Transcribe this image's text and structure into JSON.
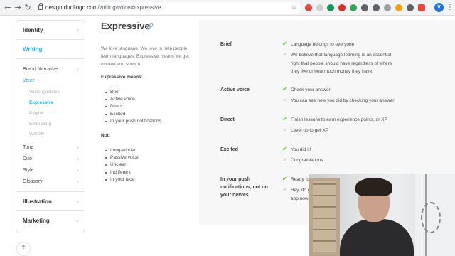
{
  "browser": {
    "nav": {
      "back": "←",
      "forward": "→",
      "reload": "↻"
    },
    "url_domain": "design.duolingo.com",
    "url_path": "/writing/voice#expressive",
    "bookmark_icon": "☆",
    "avatar_letter": "V",
    "menu_icon": "⋮",
    "extension_colors": [
      "#e8453c",
      "#d1d1d1",
      "#0f9d58",
      "#d93025",
      "#34a853",
      "#5f6368",
      "#5f6368",
      "#9aa0a6",
      "#ffa000",
      "#5f6368"
    ]
  },
  "sidebar": {
    "sections": [
      {
        "label": "Identity",
        "chevron": "›"
      },
      {
        "label": "Writing",
        "chevron": ""
      }
    ],
    "items": [
      {
        "label": "Brand Narrative",
        "chevron": "›"
      },
      {
        "label": "Voice",
        "chevron": ""
      }
    ],
    "voice_subitems": [
      "Voice Qualities",
      "Expressive",
      "Playful",
      "Embracing",
      "Worldly"
    ],
    "lower_items": [
      {
        "label": "Tone",
        "chevron": "›"
      },
      {
        "label": "Duo",
        "chevron": "›"
      },
      {
        "label": "Style",
        "chevron": "›"
      },
      {
        "label": "Glossary",
        "chevron": "›"
      }
    ],
    "bottom_sections": [
      {
        "label": "Illustration",
        "chevron": "›"
      },
      {
        "label": "Marketing",
        "chevron": "›"
      }
    ],
    "back_to_top_icon": "↑"
  },
  "main": {
    "title": "Expressive",
    "anchor_icon": "🔗",
    "intro": "We love language. We love to help people learn languages. Expressive means we get excited and show it.",
    "means_heading": "Expressive means:",
    "means": [
      "Brief",
      "Active voice",
      "Direct",
      "Excited",
      "In your push notifications"
    ],
    "not_heading": "Not:",
    "not": [
      "Long-winded",
      "Passive voice",
      "Unclear",
      "Indifferent",
      "In your face"
    ]
  },
  "examples": {
    "ok_icon": "✔",
    "no_icon": "✕",
    "rows": [
      {
        "label": "Brief",
        "do": "Language belongs to everyone",
        "dont": "We believe that language learning is an essential right that people should have regardless of where they live or how much money they have."
      },
      {
        "label": "Active voice",
        "do": "Check your answer",
        "dont": "You can see how you did by checking your answer"
      },
      {
        "label": "Direct",
        "do": "Finish lessons to earn experience points, or XP",
        "dont": "Level up to get XP"
      },
      {
        "label": "Excited",
        "do": "You did it!",
        "dont": "Congratulations"
      },
      {
        "label": "In your push notifications, not on your nerves",
        "do": "Ready fo",
        "dont": "Hey, do y app now."
      }
    ]
  },
  "colors": {
    "accent": "#1cb0f6",
    "success": "#58cc02",
    "muted": "#afafaf",
    "panel_bg": "#f7f7f7"
  }
}
